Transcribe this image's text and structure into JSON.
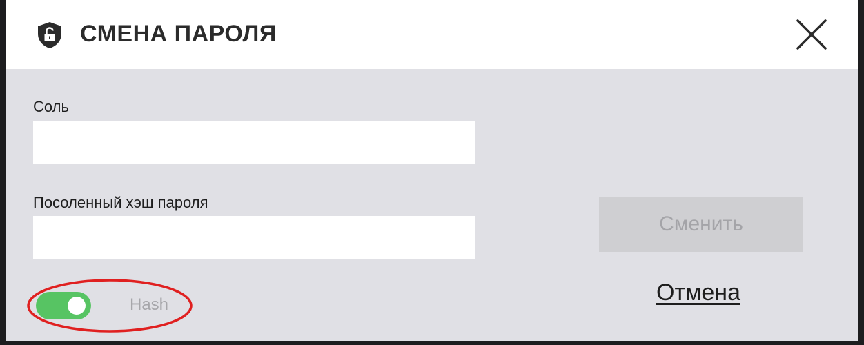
{
  "dialog": {
    "title": "СМЕНА ПАРОЛЯ",
    "header_icon": "shield-lock-icon",
    "close_icon": "close-icon"
  },
  "form": {
    "salt_label": "Соль",
    "salt_value": "",
    "hash_label": "Посоленный хэш пароля",
    "hash_value": ""
  },
  "actions": {
    "submit_label": "Сменить",
    "cancel_label": "Отмена"
  },
  "hash_toggle": {
    "label": "Hash",
    "on": true
  },
  "annotation": {
    "highlight_color": "#e02020"
  },
  "colors": {
    "toggle_on": "#57c463",
    "dialog_bg": "#e0e0e5",
    "header_bg": "#ffffff",
    "button_disabled_bg": "#cfcfd2"
  }
}
